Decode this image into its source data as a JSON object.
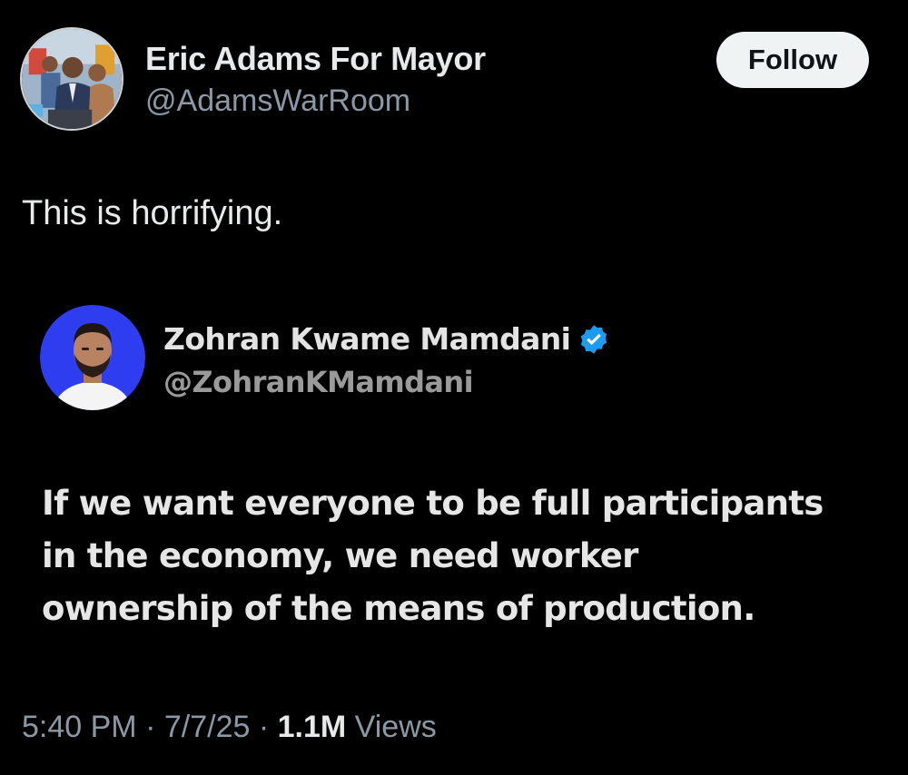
{
  "post": {
    "author": {
      "name": "Eric Adams For Mayor",
      "handle": "@AdamsWarRoom"
    },
    "follow_label": "Follow",
    "text": "This is horrifying.",
    "quoted": {
      "name": "Zohran Kwame Mamdani",
      "handle": "@ZohranKMamdani",
      "verified": true,
      "lines": [
        "If we want everyone to be full participants",
        "in the economy, we need worker",
        "ownership of the means of production."
      ]
    },
    "meta": {
      "time": "5:40 PM",
      "separator": "·",
      "date": "7/7/25",
      "views_count": "1.1M",
      "views_label": "Views"
    }
  },
  "colors": {
    "background": "#000000",
    "verified_badge": "#1d9bf0",
    "follow_button_bg": "#eff3f4",
    "secondary_text": "#8b98a5"
  }
}
